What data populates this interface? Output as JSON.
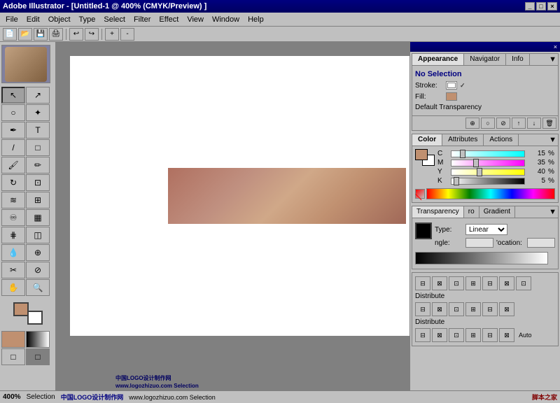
{
  "titleBar": {
    "title": "Adobe Illustrator - [Untitled-1 @ 400% (CMYK/Preview) ]",
    "minBtn": "_",
    "maxBtn": "□",
    "closeBtn": "×"
  },
  "menuBar": {
    "items": [
      "File",
      "Edit",
      "Object",
      "Type",
      "Select",
      "Filter",
      "Effect",
      "View",
      "Window",
      "Help"
    ]
  },
  "appearance": {
    "tabs": [
      "Appearance",
      "Navigator",
      "Info"
    ],
    "title": "No Selection",
    "strokeLabel": "Stroke:",
    "fillLabel": "Fill:",
    "transparencyLabel": "Default Transparency"
  },
  "color": {
    "tabs": [
      "Color",
      "Attributes",
      "Actions"
    ],
    "labels": {
      "c": "C",
      "m": "M",
      "y": "Y",
      "k": "K"
    },
    "values": {
      "c": "15",
      "m": "35",
      "y": "40",
      "k": "5"
    },
    "percent": "%"
  },
  "transparency": {
    "tabs": [
      "Transparency",
      "ro",
      "Gradient"
    ],
    "typeLabel": "Type:",
    "angleLabel": "ngle:",
    "locationLabel": "'ocation:"
  },
  "align": {
    "distributeLabel": "Distribute",
    "distributeLabel2": "Distribute"
  },
  "statusBar": {
    "zoom": "400%",
    "mode": "Selection",
    "watermark": "中国LOGO设计制作网",
    "url": "www.logozhizuo.com Selection",
    "watermark2": "脚本之家"
  },
  "tools": {
    "selection": "↖",
    "directSelect": "↗",
    "lasso": "○",
    "magic": "✦",
    "pen": "✒",
    "text": "T",
    "line": "/",
    "rect": "□",
    "ellipse": "○",
    "paintbrush": "🖌",
    "pencil": "✏",
    "rotate": "↻",
    "scale": "⊡",
    "warp": "≋",
    "freeTransform": "⊞",
    "symbol": "♾",
    "columnGraph": "▦",
    "mesh": "⋕",
    "gradient": "◫",
    "eyedropper": "💧",
    "blend": "⊕",
    "autoTrace": "✄",
    "slice": "⊘",
    "scissors": "✂",
    "hand": "✋",
    "zoom": "🔍",
    "fillFg": "#c09070",
    "fillBg": "white"
  }
}
